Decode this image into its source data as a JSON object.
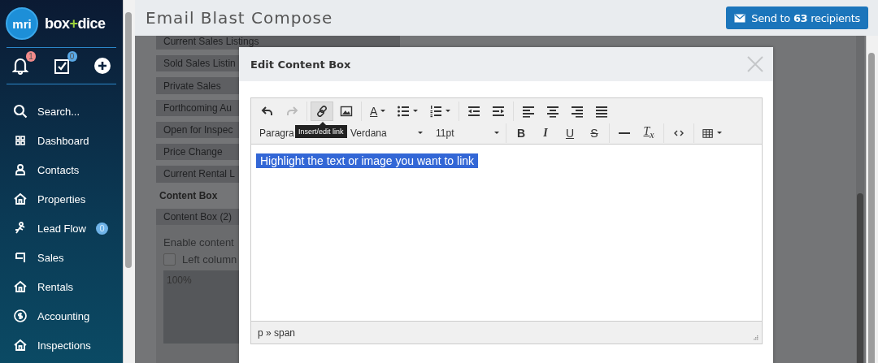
{
  "sidebar": {
    "brand": {
      "logo": "mri",
      "name_before": "box",
      "joiner": "+",
      "name_after": "dice"
    },
    "quick_actions": [
      {
        "badge": "1",
        "color": "#f08b8b"
      },
      {
        "badge": "0",
        "color": "#5aa9e6"
      }
    ],
    "nav": [
      {
        "label": "Search..."
      },
      {
        "label": "Dashboard"
      },
      {
        "label": "Contacts"
      },
      {
        "label": "Properties"
      },
      {
        "label": "Lead Flow",
        "badge": "0"
      },
      {
        "label": "Sales"
      },
      {
        "label": "Rentals"
      },
      {
        "label": "Accounting"
      },
      {
        "label": "Inspections"
      }
    ]
  },
  "header": {
    "title": "Email Blast Compose",
    "send_button": "Send to **63** recipients"
  },
  "sections": [
    {
      "label": "Current Sales Listings",
      "selected": false
    },
    {
      "label": "Sold Sales Listin",
      "selected": false
    },
    {
      "label": "Private Sales",
      "selected": false
    },
    {
      "label": "Forthcoming Au",
      "selected": false
    },
    {
      "label": "Open for Inspec",
      "selected": false
    },
    {
      "label": "Price Change",
      "selected": false
    },
    {
      "label": "Current Rental L",
      "selected": false
    },
    {
      "label": "Content Box",
      "selected": true
    },
    {
      "label": "Content Box (2)",
      "selected": false
    }
  ],
  "section_panel": {
    "label": "Enable content",
    "checkbox": {
      "label": "Left column",
      "checked": false
    },
    "width_value": "100%"
  },
  "modal": {
    "title": "Edit Content Box",
    "toolbar_row_1": [
      [
        {
          "active": false,
          "disabled": false
        },
        {
          "active": false,
          "disabled": true
        }
      ],
      [
        {
          "active": true,
          "disabled": false
        },
        {
          "active": false,
          "disabled": false
        }
      ],
      [
        {
          "label": "A",
          "menu": true,
          "active": false,
          "disabled": false
        },
        {
          "menu": true,
          "active": false,
          "disabled": false
        },
        {
          "menu": true,
          "active": false,
          "disabled": false
        }
      ],
      [
        {
          "active": false,
          "disabled": false
        },
        {
          "active": false,
          "disabled": false
        }
      ],
      [
        {
          "active": false,
          "disabled": false
        },
        {
          "active": false,
          "disabled": false
        },
        {
          "active": false,
          "disabled": false
        },
        {
          "active": false,
          "disabled": false
        }
      ]
    ],
    "format_select": "Paragra",
    "font_select": "Verdana",
    "size_select": "11pt",
    "toolbar_row_2": [
      [
        {
          "label": "B",
          "active": false,
          "disabled": false
        },
        {
          "label": "I",
          "active": false,
          "disabled": false
        },
        {
          "label": "U",
          "active": false,
          "disabled": false
        },
        {
          "label": "S",
          "active": false,
          "disabled": false
        }
      ],
      [
        {
          "active": false,
          "disabled": false
        },
        {
          "label": "T$_{x}$",
          "active": false,
          "disabled": false
        }
      ],
      [
        {
          "active": false,
          "disabled": false
        }
      ],
      [
        {
          "menu": true,
          "active": false,
          "disabled": false
        }
      ]
    ],
    "tooltip": "Insert/edit link",
    "content": {
      "text": "Highlight the text or image you want to link",
      "selected": true
    },
    "status_path": "p » span"
  }
}
